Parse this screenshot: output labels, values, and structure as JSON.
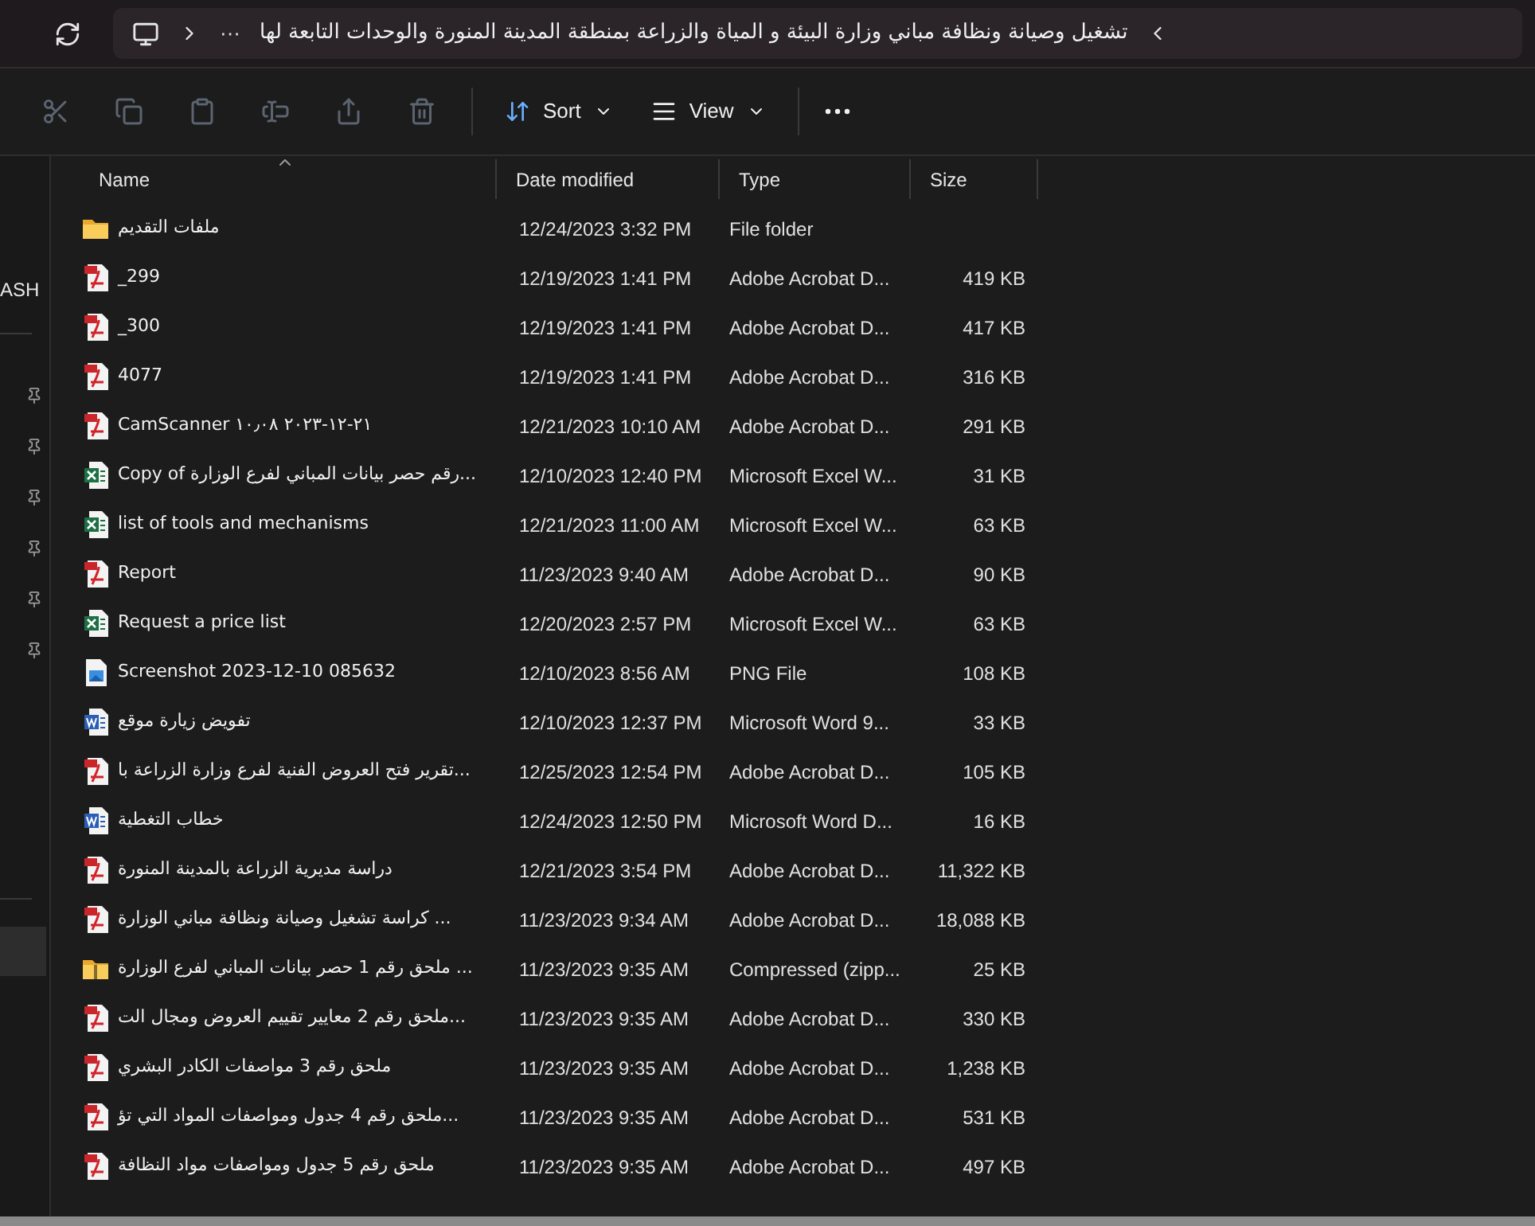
{
  "address_bar": {
    "breadcrumb": "تشغيل وصيانة ونظافة مباني وزارة البيئة و المياة والزراعة بمنطقة المدينة المنورة والوحدات التابعة لها",
    "overflow": "···"
  },
  "toolbar": {
    "actions": [
      {
        "kind": "cut",
        "disabled": true
      },
      {
        "kind": "copy",
        "disabled": true
      },
      {
        "kind": "paste",
        "disabled": true
      },
      {
        "kind": "rename",
        "disabled": true
      },
      {
        "kind": "share",
        "disabled": true
      },
      {
        "kind": "delete",
        "disabled": true
      }
    ],
    "sort": "Sort",
    "view": "View"
  },
  "sidebar": {
    "items": [
      {
        "label": "ASH"
      }
    ]
  },
  "table": {
    "columns": [
      {
        "label": "Name",
        "sorted": true
      },
      {
        "label": "Date modified",
        "sorted": false
      },
      {
        "label": "Type",
        "sorted": false
      },
      {
        "label": "Size",
        "sorted": false
      }
    ],
    "rows": [
      {
        "kind": "folder",
        "name": "ملفات التقديم",
        "date": "12/24/2023 3:32 PM",
        "type": "File folder",
        "size": ""
      },
      {
        "kind": "pdf",
        "name": "_299",
        "date": "12/19/2023 1:41 PM",
        "type": "Adobe Acrobat D...",
        "size": "419 KB"
      },
      {
        "kind": "pdf",
        "name": "_300",
        "date": "12/19/2023 1:41 PM",
        "type": "Adobe Acrobat D...",
        "size": "417 KB"
      },
      {
        "kind": "pdf",
        "name": "4077",
        "date": "12/19/2023 1:41 PM",
        "type": "Adobe Acrobat D...",
        "size": "316 KB"
      },
      {
        "kind": "pdf",
        "name": "CamScanner ٢١-١٢-٢٠٢٣ ١٠٫٠٨",
        "date": "12/21/2023 10:10 AM",
        "type": "Adobe Acrobat D...",
        "size": "291 KB"
      },
      {
        "kind": "excel",
        "name": "Copy of رقم حصر بيانات المباني لفرع الوزارة...",
        "date": "12/10/2023 12:40 PM",
        "type": "Microsoft Excel W...",
        "size": "31 KB"
      },
      {
        "kind": "excel",
        "name": "list of tools and mechanisms",
        "date": "12/21/2023 11:00 AM",
        "type": "Microsoft Excel W...",
        "size": "63 KB"
      },
      {
        "kind": "pdf",
        "name": "Report",
        "date": "11/23/2023 9:40 AM",
        "type": "Adobe Acrobat D...",
        "size": "90 KB"
      },
      {
        "kind": "excel",
        "name": "Request a price list",
        "date": "12/20/2023 2:57 PM",
        "type": "Microsoft Excel W...",
        "size": "63 KB"
      },
      {
        "kind": "png",
        "name": "Screenshot 2023-12-10 085632",
        "date": "12/10/2023 8:56 AM",
        "type": "PNG File",
        "size": "108 KB"
      },
      {
        "kind": "word",
        "name": "تفويض زيارة موقع",
        "date": "12/10/2023 12:37 PM",
        "type": "Microsoft Word 9...",
        "size": "33 KB"
      },
      {
        "kind": "pdf",
        "name": "تقرير فتح العروض الفنية لفرع وزارة الزراعة با...",
        "date": "12/25/2023 12:54 PM",
        "type": "Adobe Acrobat D...",
        "size": "105 KB"
      },
      {
        "kind": "word",
        "name": "خطاب التغطية",
        "date": "12/24/2023 12:50 PM",
        "type": "Microsoft Word D...",
        "size": "16 KB"
      },
      {
        "kind": "pdf",
        "name": "دراسة مديرية الزراعة بالمدينة المنورة",
        "date": "12/21/2023 3:54 PM",
        "type": "Adobe Acrobat D...",
        "size": "11,322 KB"
      },
      {
        "kind": "pdf",
        "name": "كراسة تشغيل وصيانة ونظافة مباني الوزارة ...",
        "date": "11/23/2023 9:34 AM",
        "type": "Adobe Acrobat D...",
        "size": "18,088 KB"
      },
      {
        "kind": "zip",
        "name": "ملحق رقم 1 حصر بيانات المباني لفرع الوزارة ...",
        "date": "11/23/2023 9:35 AM",
        "type": "Compressed (zipp...",
        "size": "25 KB"
      },
      {
        "kind": "pdf",
        "name": "ملحق رقم 2 معايير تقييم العروض ومجال الت...",
        "date": "11/23/2023 9:35 AM",
        "type": "Adobe Acrobat D...",
        "size": "330 KB"
      },
      {
        "kind": "pdf",
        "name": "ملحق رقم 3 مواصفات الكادر البشري",
        "date": "11/23/2023 9:35 AM",
        "type": "Adobe Acrobat D...",
        "size": "1,238 KB"
      },
      {
        "kind": "pdf",
        "name": "ملحق رقم 4 جدول ومواصفات المواد التي تؤ...",
        "date": "11/23/2023 9:35 AM",
        "type": "Adobe Acrobat D...",
        "size": "531 KB"
      },
      {
        "kind": "pdf",
        "name": "ملحق رقم 5 جدول ومواصفات مواد النظافة",
        "date": "11/23/2023 9:35 AM",
        "type": "Adobe Acrobat D...",
        "size": "497 KB"
      }
    ]
  }
}
